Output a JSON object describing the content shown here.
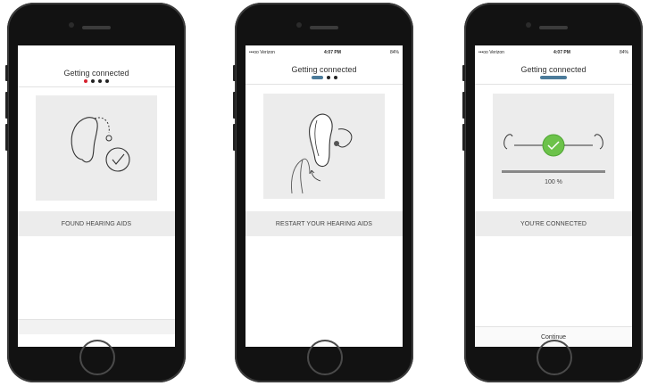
{
  "screens": [
    {
      "title": "Getting connected",
      "band_text": "FOUND HEARING AIDS",
      "illustration": "hearing-aid-check-icon"
    },
    {
      "status": {
        "left": "•••oo Verizon",
        "time": "4:07 PM",
        "right": "84%"
      },
      "title": "Getting connected",
      "band_text": "RESTART YOUR HEARING AIDS",
      "illustration": "hand-restart-hearing-aid-icon"
    },
    {
      "status": {
        "left": "•••oo Verizon",
        "time": "4:07 PM",
        "right": "84%"
      },
      "title": "Getting connected",
      "progress_text": "100 %",
      "progress_value": 1.0,
      "band_text": "YOU'RE CONNECTED",
      "continue_label": "Continue",
      "illustration": "connected-hearing-aids-icon"
    }
  ],
  "colors": {
    "accent_green": "#6cc24a",
    "progress_blue": "#4b7b9a",
    "step_red": "#d6202e"
  }
}
